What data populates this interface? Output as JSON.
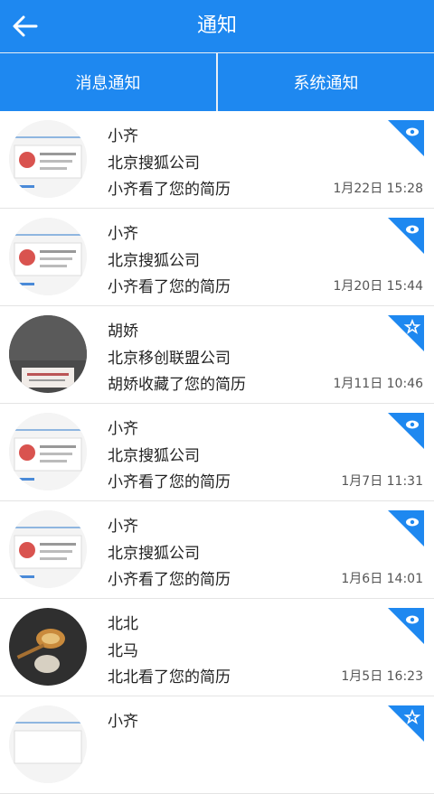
{
  "header": {
    "title": "通知",
    "back_icon": "arrow-left-icon"
  },
  "tabs": [
    {
      "label": "消息通知"
    },
    {
      "label": "系统通知"
    }
  ],
  "colors": {
    "primary": "#1e88f0",
    "divider": "#e4e4e4"
  },
  "notifications": [
    {
      "name": "小齐",
      "company": "北京搜狐公司",
      "action": "小齐看了您的简历",
      "time": "1月22日 15:28",
      "badge_icon": "eye-icon",
      "avatar": "resume-card"
    },
    {
      "name": "小齐",
      "company": "北京搜狐公司",
      "action": "小齐看了您的简历",
      "time": "1月20日 15:44",
      "badge_icon": "eye-icon",
      "avatar": "resume-card"
    },
    {
      "name": "胡娇",
      "company": "北京移创联盟公司",
      "action": "胡娇收藏了您的简历",
      "time": "1月11日 10:46",
      "badge_icon": "star-icon",
      "avatar": "dark-photo"
    },
    {
      "name": "小齐",
      "company": "北京搜狐公司",
      "action": "小齐看了您的简历",
      "time": "1月7日 11:31",
      "badge_icon": "eye-icon",
      "avatar": "resume-card"
    },
    {
      "name": "小齐",
      "company": "北京搜狐公司",
      "action": "小齐看了您的简历",
      "time": "1月6日 14:01",
      "badge_icon": "eye-icon",
      "avatar": "resume-card"
    },
    {
      "name": "北北",
      "company": "北马",
      "action": "北北看了您的简历",
      "time": "1月5日 16:23",
      "badge_icon": "eye-icon",
      "avatar": "spoons-photo"
    },
    {
      "name": "小齐",
      "company": "",
      "action": "",
      "time": "",
      "badge_icon": "star-icon",
      "avatar": "resume-card"
    }
  ]
}
